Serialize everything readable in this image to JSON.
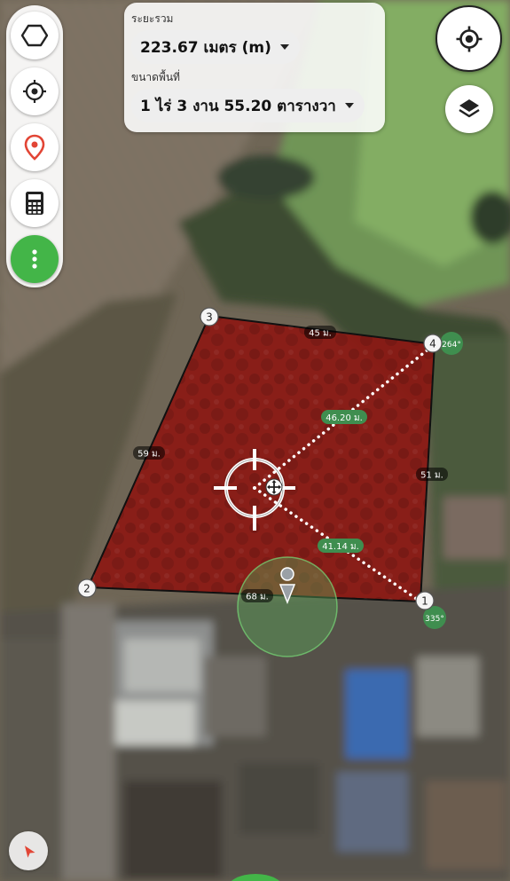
{
  "header": {
    "distance_label": "ระยะรวม",
    "distance_value": "223.67 เมตร (m)",
    "area_label": "ขนาดพื้นที่",
    "area_value": "1 ไร่ 3 งาน 55.20 ตารางวา"
  },
  "toolbar": {
    "items": [
      {
        "name": "polygon-icon"
      },
      {
        "name": "crosshair-icon"
      },
      {
        "name": "map-pin-icon"
      },
      {
        "name": "calculator-icon"
      },
      {
        "name": "more-vertical-icon"
      }
    ]
  },
  "right_controls": [
    {
      "name": "my-location-icon"
    },
    {
      "name": "layers-icon"
    }
  ],
  "colors": {
    "polygon_fill": "#8b1a14",
    "label_green": "#3f8e4f",
    "accent_green": "#43b548",
    "pin_red": "#e24535"
  },
  "polygon": {
    "vertices": [
      "1",
      "2",
      "3",
      "4"
    ],
    "edges": [
      {
        "id": "edge-3-4",
        "label": "45 ม."
      },
      {
        "id": "edge-2-3",
        "label": "59 ม."
      },
      {
        "id": "edge-4-1",
        "label": "51 ม."
      },
      {
        "id": "edge-2-1",
        "label": "68 ม."
      }
    ],
    "bearings": [
      "264°",
      "335°"
    ],
    "center_distances": [
      "46.20 ม.",
      "41.14 ม."
    ]
  }
}
